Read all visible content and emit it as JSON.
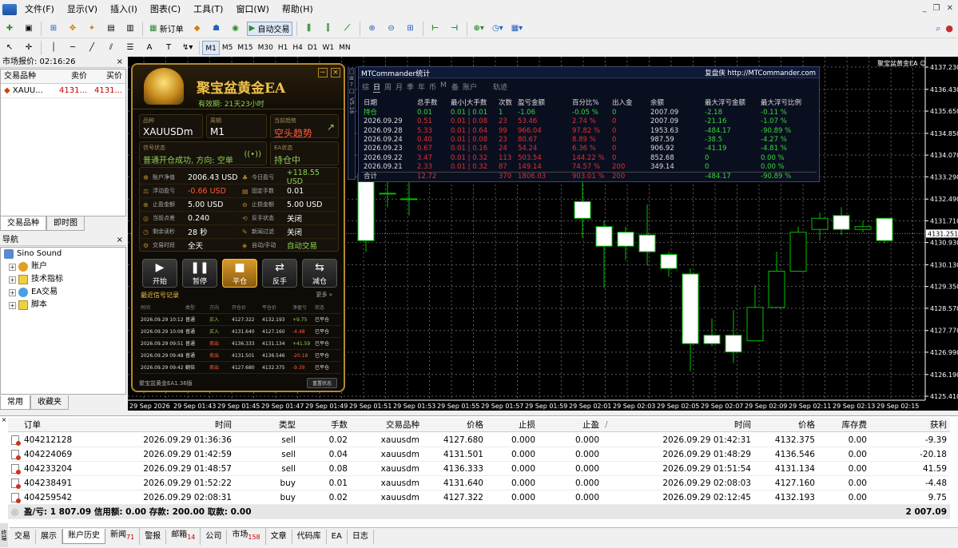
{
  "menu": [
    "文件(F)",
    "显示(V)",
    "插入(I)",
    "图表(C)",
    "工具(T)",
    "窗口(W)",
    "帮助(H)"
  ],
  "toolbar": {
    "new_order": "新订单",
    "auto_trade": "自动交易"
  },
  "timeframes": [
    "M1",
    "M5",
    "M15",
    "M30",
    "H1",
    "H4",
    "D1",
    "W1",
    "MN"
  ],
  "market_watch": {
    "title": "市场报价: 02:16:26",
    "headers": [
      "交易品种",
      "卖价",
      "买价"
    ],
    "rows": [
      {
        "symbol": "XAUU...",
        "bid": "4131...",
        "ask": "4131..."
      }
    ],
    "tabs": [
      "交易品种",
      "即时图"
    ]
  },
  "navigator": {
    "title": "导航",
    "root": "Sino Sound",
    "items": [
      "账户",
      "技术指标",
      "EA交易",
      "脚本"
    ],
    "tabs": [
      "常用",
      "收藏夹"
    ]
  },
  "ea": {
    "title": "聚宝盆黄金EA",
    "validity": "有效期: 21天23小时",
    "symbol_label": "品种",
    "symbol": "XAUUSDm",
    "period_label": "周期",
    "period": "M1",
    "trend_label": "当前趋势",
    "trend": "空头趋势",
    "signal_label": "信号状态",
    "signal": "普通开仓成功, 方向: 空单",
    "ea_status_label": "EA状态",
    "ea_status": "持仓中",
    "version": "V5.16",
    "stats": [
      {
        "label": "账户净值",
        "value": "2006.43 USD"
      },
      {
        "label": "今日盈亏",
        "value": "+118.55 USD"
      },
      {
        "label": "浮动盈亏",
        "value": "-0.66 USD"
      },
      {
        "label": "固定手数",
        "value": "0.01"
      },
      {
        "label": "止盈金额",
        "value": "5.00 USD"
      },
      {
        "label": "止损金额",
        "value": "5.00 USD"
      },
      {
        "label": "当前点差",
        "value": "0.240"
      },
      {
        "label": "反手状态",
        "value": "关闭"
      },
      {
        "label": "剩余读秒",
        "value": "28 秒"
      },
      {
        "label": "新闻过滤",
        "value": "关闭"
      },
      {
        "label": "交易时段",
        "value": "全天"
      },
      {
        "label": "自动/手动",
        "value": "自动交易"
      }
    ],
    "buttons": [
      "开始",
      "暂停",
      "平仓",
      "反手",
      "减仓"
    ],
    "signals_title": "最近信号记录",
    "signals_more": "更多 »",
    "signal_headers": [
      "时间",
      "类型",
      "方向",
      "开仓价",
      "平仓价",
      "净盈亏",
      "状态"
    ],
    "signals": [
      [
        "2026.09.29 10:12",
        "普通",
        "买入",
        "4127.322",
        "4132.193",
        "+9.75",
        "已平仓"
      ],
      [
        "2026.09.29 10:08",
        "普通",
        "买入",
        "4131.640",
        "4127.160",
        "-4.48",
        "已平仓"
      ],
      [
        "2026.09.29 09:51",
        "普通",
        "卖出",
        "4136.333",
        "4131.134",
        "+41.59",
        "已平仓"
      ],
      [
        "2026.09.29 09:48",
        "普通",
        "卖出",
        "4131.501",
        "4136.546",
        "-20.18",
        "已平仓"
      ],
      [
        "2026.09.29 09:42",
        "翻倍",
        "卖出",
        "4127.680",
        "4132.375",
        "-9.39",
        "已平仓"
      ]
    ],
    "footer": "聚宝盆黄金EA1.36版",
    "footer_btn": "重置状态"
  },
  "stats_panel": {
    "title": "MTCommander统计",
    "link": "复盘侠 http://MTCommander.com",
    "tabs": [
      "综",
      "日",
      "周",
      "月",
      "季",
      "年",
      "币",
      "M",
      "备",
      "账户",
      "轨迹"
    ],
    "headers": [
      "日期",
      "总手数",
      "最小|大手数",
      "次数",
      "盈亏金额",
      "百分比%",
      "出入金",
      "余额",
      "最大浮亏金额",
      "最大浮亏比例"
    ],
    "rows": [
      {
        "c": "g",
        "v": [
          "持仓",
          "0.01",
          "0.01 | 0.01",
          "1",
          "-1.06",
          "-0.05 %",
          "0",
          "2007.09",
          "-2.18",
          "-0.11 %"
        ]
      },
      {
        "c": "r",
        "v": [
          "2026.09.29",
          "0.51",
          "0.01 | 0.08",
          "23",
          "53.46",
          "2.74 %",
          "0",
          "2007.09",
          "-21.16",
          "-1.07 %"
        ]
      },
      {
        "c": "r",
        "v": [
          "2026.09.28",
          "5.33",
          "0.01 | 0.64",
          "99",
          "966.04",
          "97.82 %",
          "0",
          "1953.63",
          "-484.17",
          "-90.89 %"
        ]
      },
      {
        "c": "r",
        "v": [
          "2026.09.24",
          "0.40",
          "0.01 | 0.08",
          "23",
          "80.67",
          "8.89 %",
          "0",
          "987.59",
          "-38.5",
          "-4.27 %"
        ]
      },
      {
        "c": "r",
        "v": [
          "2026.09.23",
          "0.67",
          "0.01 | 0.16",
          "24",
          "54.24",
          "6.36 %",
          "0",
          "906.92",
          "-41.19",
          "-4.81 %"
        ]
      },
      {
        "c": "r",
        "v": [
          "2026.09.22",
          "3.47",
          "0.01 | 0.32",
          "113",
          "503.54",
          "144.22 %",
          "0",
          "852.68",
          "0",
          "0.00 %"
        ]
      },
      {
        "c": "r",
        "v": [
          "2026.09.21",
          "2.33",
          "0.01 | 0.32",
          "87",
          "149.14",
          "74.57 %",
          "200",
          "349.14",
          "0",
          "0.00 %"
        ]
      },
      {
        "c": "t",
        "v": [
          "合计",
          "12.72",
          "",
          "370",
          "1806.03",
          "903.01 %",
          "200",
          "",
          "-484.17",
          "-90.89 %"
        ]
      }
    ]
  },
  "chart": {
    "symbol_label": "聚宝盆黄金EA ☺",
    "price_levels": [
      "4137.230",
      "4136.430",
      "4135.650",
      "4134.850",
      "4134.070",
      "4133.290",
      "4132.490",
      "4131.710",
      "4130.930",
      "4130.130",
      "4129.350",
      "4128.570",
      "4127.770",
      "4126.990",
      "4126.190",
      "4125.410"
    ],
    "current_price": "4131.251",
    "time_labels": [
      "29 Sep 2026",
      "29 Sep 01:43",
      "29 Sep 01:45",
      "29 Sep 01:47",
      "29 Sep 01:49",
      "29 Sep 01:51",
      "29 Sep 01:53",
      "29 Sep 01:55",
      "29 Sep 01:57",
      "29 Sep 01:59",
      "29 Sep 02:01",
      "29 Sep 02:03",
      "29 Sep 02:05",
      "29 Sep 02:07",
      "29 Sep 02:09",
      "29 Sep 02:11",
      "29 Sep 02:13",
      "29 Sep 02:15"
    ]
  },
  "terminal": {
    "headers": [
      "订单",
      "时间",
      "类型",
      "手数",
      "交易品种",
      "价格",
      "止损",
      "止盈",
      "时间",
      "价格",
      "库存费",
      "获利"
    ],
    "sort_mark": "/",
    "rows": [
      [
        "404212128",
        "2026.09.29 01:36:36",
        "sell",
        "0.02",
        "xauusdm",
        "4127.680",
        "0.000",
        "0.000",
        "2026.09.29 01:42:31",
        "4132.375",
        "0.00",
        "-9.39"
      ],
      [
        "404224069",
        "2026.09.29 01:42:59",
        "sell",
        "0.04",
        "xauusdm",
        "4131.501",
        "0.000",
        "0.000",
        "2026.09.29 01:48:29",
        "4136.546",
        "0.00",
        "-20.18"
      ],
      [
        "404233204",
        "2026.09.29 01:48:57",
        "sell",
        "0.08",
        "xauusdm",
        "4136.333",
        "0.000",
        "0.000",
        "2026.09.29 01:51:54",
        "4131.134",
        "0.00",
        "41.59"
      ],
      [
        "404238491",
        "2026.09.29 01:52:22",
        "buy",
        "0.01",
        "xauusdm",
        "4131.640",
        "0.000",
        "0.000",
        "2026.09.29 02:08:03",
        "4127.160",
        "0.00",
        "-4.48"
      ],
      [
        "404259542",
        "2026.09.29 02:08:31",
        "buy",
        "0.02",
        "xauusdm",
        "4127.322",
        "0.000",
        "0.000",
        "2026.09.29 02:12:45",
        "4132.193",
        "0.00",
        "9.75"
      ]
    ],
    "summary": "盈/亏: 1 807.09 信用额: 0.00 存款: 200.00 取款: 0.00",
    "summary_total": "2 007.09",
    "side_label": "终端",
    "tabs": [
      {
        "label": "交易"
      },
      {
        "label": "展示"
      },
      {
        "label": "账户历史",
        "active": true
      },
      {
        "label": "新闻",
        "badge": "71"
      },
      {
        "label": "警报"
      },
      {
        "label": "邮箱",
        "badge": "14"
      },
      {
        "label": "公司"
      },
      {
        "label": "市场",
        "badge": "158"
      },
      {
        "label": "文章"
      },
      {
        "label": "代码库"
      },
      {
        "label": "EA"
      },
      {
        "label": "日志"
      }
    ]
  }
}
